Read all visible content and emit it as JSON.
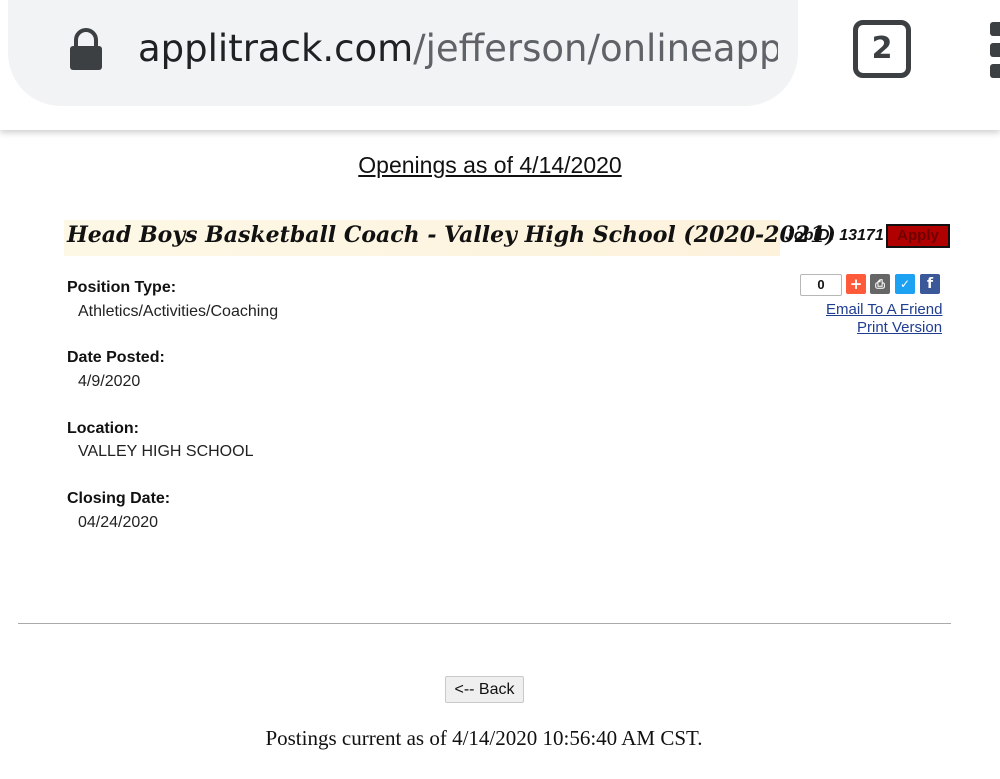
{
  "browser": {
    "url_domain": "applitrack.com",
    "url_path": "/jefferson/onlineapp/Jc",
    "tab_count": "2"
  },
  "page": {
    "header": "Openings as of 4/14/2020",
    "job_title": "Head Boys Basketball Coach - Valley High School (2020-2021)",
    "job_id": "JobID: 13171",
    "apply_label": "Apply"
  },
  "fields": [
    {
      "label": "Position Type:",
      "value": "Athletics/Activities/Coaching"
    },
    {
      "label": "Date Posted:",
      "value": "4/9/2020"
    },
    {
      "label": "Location:",
      "value": "VALLEY HIGH SCHOOL"
    },
    {
      "label": "Closing Date:",
      "value": "04/24/2020"
    }
  ],
  "share": {
    "count": "0",
    "icons": [
      "plus-icon",
      "print-icon",
      "twitter-icon",
      "facebook-icon"
    ],
    "email_label": "Email To A Friend",
    "print_label": "Print Version"
  },
  "footer": {
    "back_label": "<-- Back",
    "timestamp_text": "Postings current as of 4/14/2020 10:56:40 AM CST."
  },
  "colors": {
    "apply_bg": "#b10000",
    "link": "#1f3d91",
    "title_band": "#fdf5e0"
  }
}
